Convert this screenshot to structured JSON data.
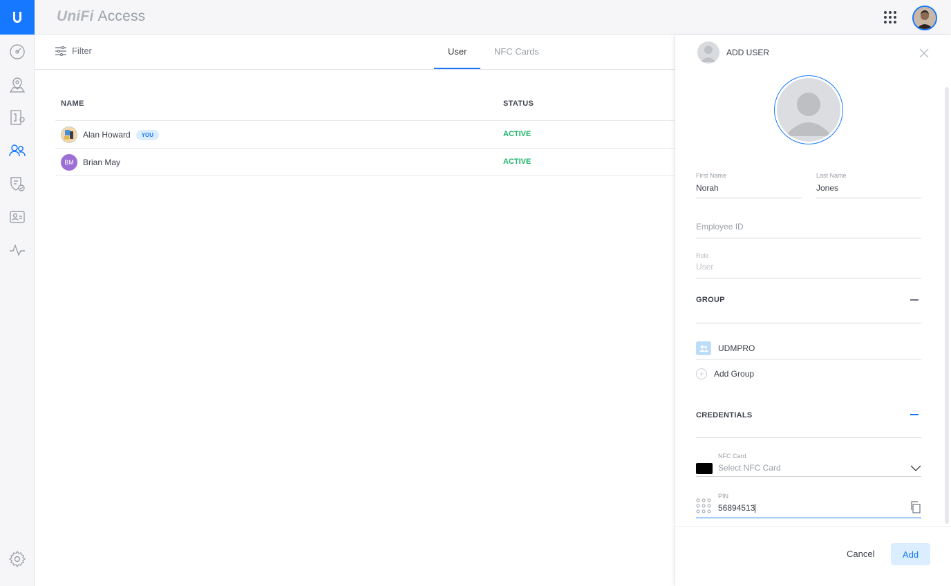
{
  "app": {
    "brand_prefix": "UniFi",
    "brand_name": "Access"
  },
  "sidebar": {
    "items": [
      {
        "icon": "dashboard-icon"
      },
      {
        "icon": "map-icon"
      },
      {
        "icon": "doors-icon"
      },
      {
        "icon": "users-icon",
        "active": true
      },
      {
        "icon": "access-policy-icon"
      },
      {
        "icon": "visitor-icon"
      },
      {
        "icon": "activity-icon"
      },
      {
        "icon": "settings-icon"
      }
    ]
  },
  "toolbar": {
    "filter_label": "Filter",
    "tabs": [
      {
        "label": "User",
        "active": true
      },
      {
        "label": "NFC Cards",
        "active": false
      }
    ]
  },
  "table": {
    "columns": [
      "NAME",
      "STATUS"
    ],
    "rows": [
      {
        "name": "Alan Howard",
        "badge": "YOU",
        "status": "ACTIVE"
      },
      {
        "name": "Brian May",
        "initials": "BM",
        "status": "ACTIVE"
      }
    ]
  },
  "panel": {
    "title": "ADD USER",
    "first_name_label": "First Name",
    "first_name": "Norah",
    "last_name_label": "Last Name",
    "last_name": "Jones",
    "employee_id_placeholder": "Employee ID",
    "role_label": "Role",
    "role_value": "User",
    "group_section": "GROUP",
    "group_item": "UDMPRO",
    "add_group_label": "Add Group",
    "credentials_section": "CREDENTIALS",
    "nfc_label": "NFC Card",
    "nfc_placeholder": "Select NFC Card",
    "pin_label": "PIN",
    "pin_value": "56894513",
    "cancel_label": "Cancel",
    "add_label": "Add"
  },
  "colors": {
    "accent": "#1677ff",
    "status_active": "#19b568",
    "badge_bg": "#dbeeff",
    "avatar_bm": "#9b6fd6"
  }
}
